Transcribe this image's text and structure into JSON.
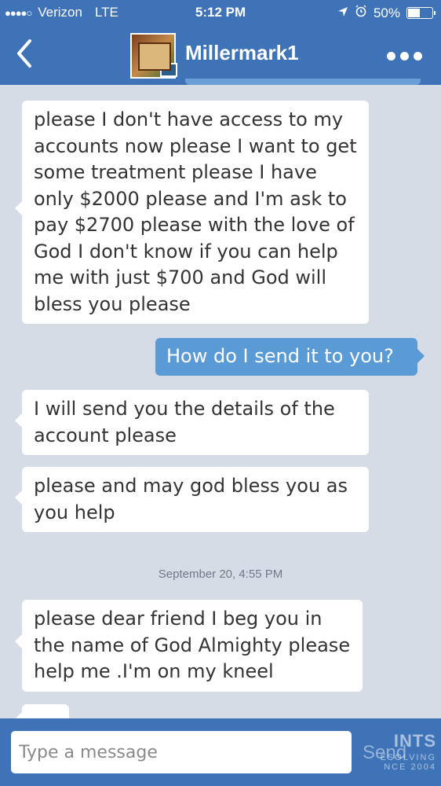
{
  "status_bar": {
    "carrier": "Verizon",
    "network": "LTE",
    "time": "5:12 PM",
    "battery": "50%",
    "battery_level": 0.5,
    "icons": [
      "signal-dots",
      "location-arrow",
      "alarm-clock",
      "battery"
    ]
  },
  "header": {
    "title": "Millermark1",
    "back_icon": "chevron-left-icon",
    "more_icon": "ellipsis-icon"
  },
  "messages": [
    {
      "direction": "in",
      "text": "please I  don't have access to my accounts now please I want to get some treatment please I have only $2000 please and I'm ask to pay $2700 please with the love of God I don't know if you can help me with just $700 and God will bless you please"
    },
    {
      "direction": "out",
      "text": "How do I send it to you?"
    },
    {
      "direction": "in",
      "text": "I will send you the details  of the account please"
    },
    {
      "direction": "in",
      "text": "please and may god bless you as you help"
    },
    {
      "direction": "in",
      "text": "please dear friend I beg you in the name of God Almighty please help me .I'm on my kneel"
    }
  ],
  "date_separator": "September 20, 4:55 PM",
  "composer": {
    "placeholder": "Type a message",
    "send_label": "Send"
  },
  "watermark": {
    "line1": "INTS",
    "line2": "ESOLVING",
    "line3": "NCE 2004"
  },
  "colors": {
    "header_bg": "#3f73b8",
    "outgoing_bubble": "#5b9bd5",
    "incoming_bubble": "#ffffff",
    "chat_bg": "#d5dce6"
  }
}
